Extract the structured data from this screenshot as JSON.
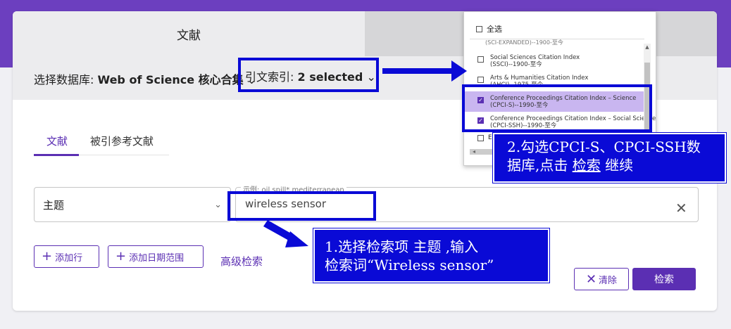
{
  "tabs": {
    "active": "文献",
    "inactive": ""
  },
  "database": {
    "label": "选择数据库:",
    "name": "Web of Science 核心合集",
    "chevron": "⌄"
  },
  "citation_index": {
    "label": "引文索引:",
    "value": "2 selected",
    "chevron": "⌄"
  },
  "subtabs": [
    "文献",
    "被引参考文献"
  ],
  "search_row": {
    "field": "主题",
    "hint": "示例: oil spill* mediterranean",
    "query": "wireless sensor",
    "clear": "✕"
  },
  "buttons": {
    "add_row": "添加行",
    "add_date": "添加日期范围",
    "advanced": "高级检索",
    "clear": "清除",
    "search": "检索"
  },
  "dropdown": {
    "select_all": "全选",
    "cut_text": "(SCI-EXPANDED)--1900-至今",
    "items": [
      {
        "line1": "Social Sciences Citation Index",
        "line2": "(SSCI)--1900-至今",
        "checked": false
      },
      {
        "line1": "Arts & Humanities Citation Index",
        "line2": "(AHCI)--1975-至今",
        "checked": false
      },
      {
        "line1": "Conference Proceedings Citation Index – Science",
        "line2": "(CPCI-S)--1990-至今",
        "checked": true
      },
      {
        "line1": "Conference Proceedings Citation Index – Social Science &",
        "line2": "(CPCI-SSH)--1990-至今",
        "checked": true
      }
    ],
    "partial": "E"
  },
  "annotations": {
    "note2_line1": "2.勾选CPCI-S、CPCI-SSH数",
    "note2_prefix": "据库,点击 ",
    "note2_link": "检索",
    "note2_suffix": " 继续",
    "note1_line1": "1.选择检索项 主题 ,输入",
    "note1_line2": "检索词“Wireless sensor”"
  },
  "colors": {
    "brand": "#6c3fbf",
    "accent": "#5b2fb3",
    "annotation": "#0a0ad6",
    "selected_row": "#c9b6f0"
  }
}
